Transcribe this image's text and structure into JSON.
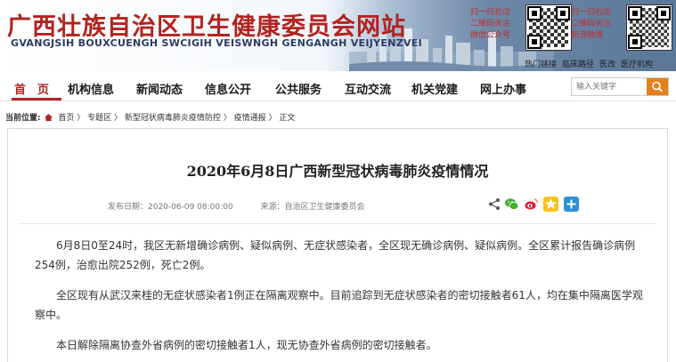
{
  "header": {
    "title": "广西壮族自治区卫生健康委员会网站",
    "subtitle": "GVANGJSIH BOUXCUENGH SWCIGIH VEISWNGH GENGANGH VEIJYENZVEI",
    "qr_left": {
      "lines": [
        "扫一扫右边",
        "二维码关注",
        "微信公众号"
      ]
    },
    "qr_right": {
      "lines": [
        "扫一扫右边",
        "二维码关注",
        "新浪微博"
      ]
    },
    "toplinks": [
      "热门链接",
      "临床路径",
      "医改",
      "医疗机构"
    ]
  },
  "nav": {
    "items": [
      "首　页",
      "机构信息",
      "新闻动态",
      "信息公开",
      "公共服务",
      "互动交流",
      "机关党建",
      "网上办事"
    ],
    "active": "首　页"
  },
  "search": {
    "placeholder": "输入关键字",
    "icon": "search-icon"
  },
  "breadcrumb": {
    "label": "当前位置:",
    "items": [
      "首页",
      "专题区",
      "新型冠状病毒肺炎疫情防控",
      "疫情通报",
      "正文"
    ]
  },
  "article": {
    "title": "2020年6月8日广西新型冠状病毒肺炎疫情情况",
    "publish_date": "发布日期：2020-06-09 08:00:00",
    "source": "来源：自治区卫生健康委员会",
    "share_icons": [
      "share-icon",
      "wechat-icon",
      "weibo-icon",
      "qzone-icon",
      "more-icon"
    ],
    "paragraphs": [
      "6月8日0至24时，我区无新增确诊病例、疑似病例、无症状感染者，全区现无确诊病例、疑似病例。全区累计报告确诊病例254例，治愈出院252例，死亡2例。",
      "全区现有从武汉来桂的无症状感染者1例正在隔离观察中。目前追踪到无症状感染者的密切接触者61人，均在集中隔离医学观察中。",
      "本日解除隔离协查外省病例的密切接触者1人，现无协查外省病例的密切接触者。"
    ]
  },
  "colors": {
    "brand_red": "#b3231f",
    "search_orange": "#e4801c",
    "subtitle_navy": "#2a3c62"
  }
}
